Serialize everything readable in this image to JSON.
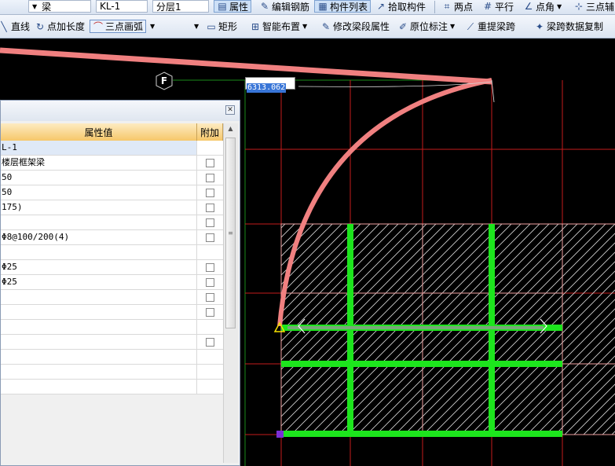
{
  "toolbar1": {
    "element_type": "梁",
    "element_name": "KL-1",
    "floor": "分层1",
    "items": [
      "属性",
      "编辑钢筋",
      "构件列表",
      "拾取构件",
      "两点",
      "平行",
      "点角",
      "三点辅"
    ]
  },
  "toolbar2": {
    "items": [
      "直线",
      "点加长度",
      "三点画弧",
      "矩形",
      "智能布置",
      "修改梁段属性",
      "原位标注",
      "重提梁跨",
      "梁跨数据复制"
    ]
  },
  "properties_panel": {
    "col_value": "属性值",
    "col_attach": "附加",
    "rows": [
      "L-1",
      "楼层框架梁",
      "50",
      "50",
      "175)",
      "",
      "Φ8@100/200(4)",
      "",
      "Φ25",
      "Φ25",
      "",
      "",
      "",
      "",
      "",
      "",
      ""
    ],
    "checkbox_rows": [
      false,
      true,
      true,
      true,
      true,
      true,
      true,
      false,
      true,
      true,
      true,
      true,
      false,
      true,
      false,
      false,
      false
    ]
  },
  "canvas": {
    "coordinate_value": "6313.062",
    "axis_label": "F"
  },
  "colors": {
    "arc": "#f08080",
    "beam": "#1de51d",
    "grid": "#c51b1b",
    "slab_outline": "#f0a0a0"
  }
}
